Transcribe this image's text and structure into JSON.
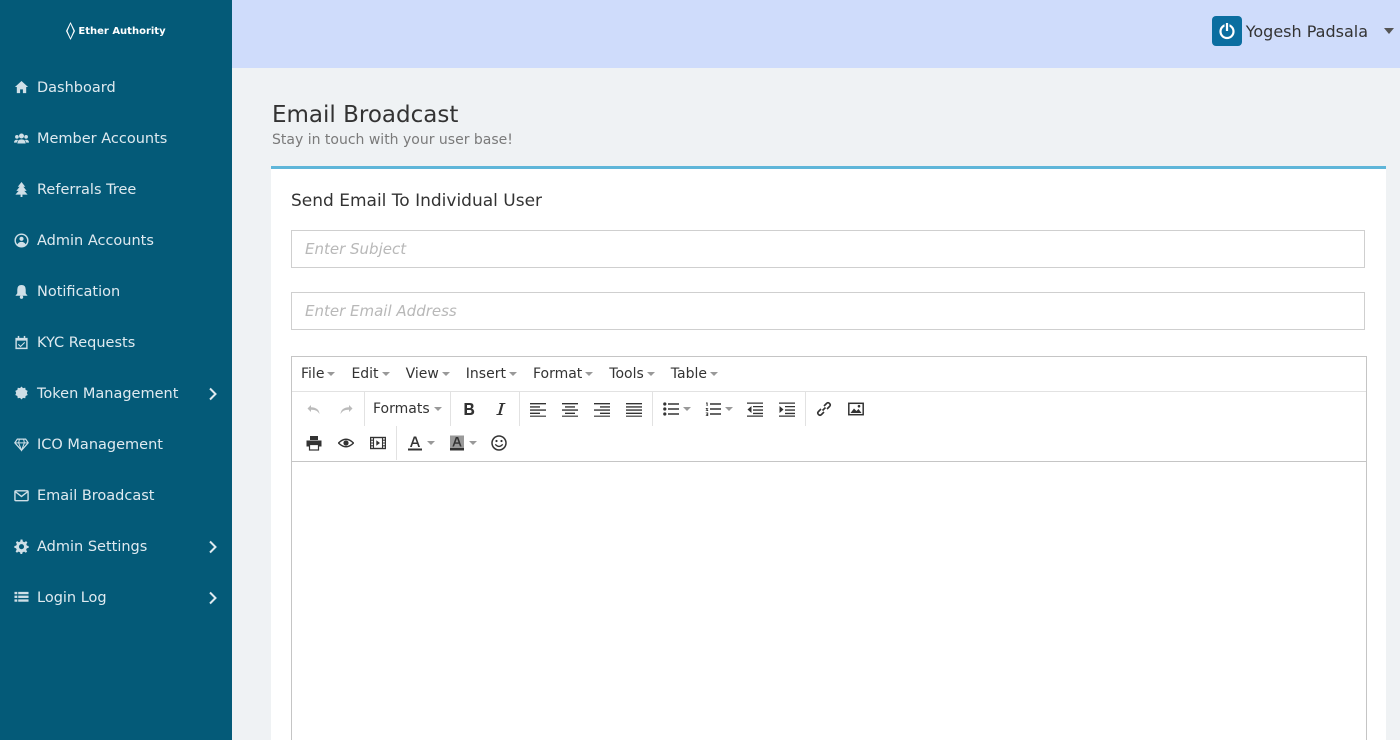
{
  "brand": {
    "logo_text": "Ether Authority"
  },
  "sidebar": {
    "items": [
      {
        "label": "Dashboard",
        "icon": "home-icon"
      },
      {
        "label": "Member Accounts",
        "icon": "users-icon"
      },
      {
        "label": "Referrals Tree",
        "icon": "tree-icon"
      },
      {
        "label": "Admin Accounts",
        "icon": "user-circle-icon"
      },
      {
        "label": "Notification",
        "icon": "bell-icon"
      },
      {
        "label": "KYC Requests",
        "icon": "calendar-check-icon"
      },
      {
        "label": "Token Management",
        "icon": "gear-badge-icon",
        "expandable": true
      },
      {
        "label": "ICO Management",
        "icon": "diamond-icon"
      },
      {
        "label": "Email Broadcast",
        "icon": "envelope-icon"
      },
      {
        "label": "Admin Settings",
        "icon": "gear-icon",
        "expandable": true
      },
      {
        "label": "Login Log",
        "icon": "list-icon",
        "expandable": true
      }
    ]
  },
  "header": {
    "user_name": "Yogesh Padsala",
    "avatar_icon": "power-icon"
  },
  "page": {
    "title": "Email Broadcast",
    "subtitle": "Stay in touch with your user base!"
  },
  "form": {
    "title": "Send Email To Individual User",
    "subject_placeholder": "Enter Subject",
    "email_placeholder": "Enter Email Address"
  },
  "editor": {
    "menus": [
      "File",
      "Edit",
      "View",
      "Insert",
      "Format",
      "Tools",
      "Table"
    ],
    "formats_label": "Formats"
  },
  "colors": {
    "sidebar": "#045a78",
    "header": "#cfdcfb",
    "accent": "#5fb6d9"
  }
}
